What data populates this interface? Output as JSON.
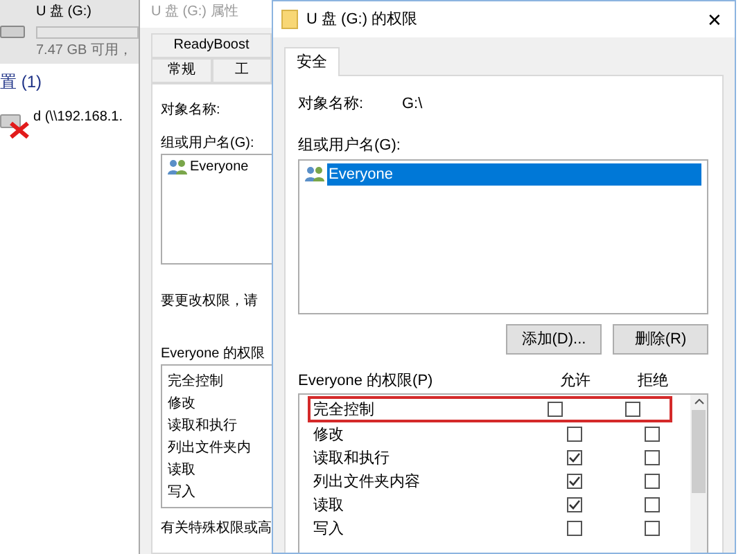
{
  "explorer": {
    "drive_name": "U 盘 (G:)",
    "drive_free": "7.47 GB 可用，",
    "section": "置 (1)",
    "network_drive": "d (\\\\192.168.1."
  },
  "properties": {
    "title": "U 盘 (G:) 属性",
    "tabs_top": [
      {
        "label": "ReadyBoost",
        "selected": false
      }
    ],
    "tabs": [
      {
        "label": "常规",
        "selected": false
      },
      {
        "label": "工",
        "selected": false
      }
    ],
    "object_label": "对象名称:",
    "group_label": "组或用户名(G):",
    "users": [
      "Everyone"
    ],
    "hint": "要更改权限，请",
    "perm_label": "Everyone 的权限",
    "permissions": [
      "完全控制",
      "修改",
      "读取和执行",
      "列出文件夹内",
      "读取",
      "写入"
    ],
    "footer": "有关特殊权限或高"
  },
  "dialog": {
    "title": "U 盘 (G:) 的权限",
    "close": "✕",
    "tabs": [
      {
        "label": "安全",
        "selected": true
      }
    ],
    "object_label": "对象名称:",
    "object_value": "G:\\",
    "group_label": "组或用户名(G):",
    "users": [
      {
        "name": "Everyone",
        "selected": true
      }
    ],
    "buttons": [
      "添加(D)...",
      "删除(R)"
    ],
    "perm_label": "Everyone 的权限(P)",
    "allow_header": "允许",
    "deny_header": "拒绝",
    "permissions": [
      {
        "name": "完全控制",
        "allow": false,
        "deny": false,
        "highlighted": true
      },
      {
        "name": "修改",
        "allow": false,
        "deny": false,
        "highlighted": false
      },
      {
        "name": "读取和执行",
        "allow": true,
        "deny": false,
        "highlighted": false
      },
      {
        "name": "列出文件夹内容",
        "allow": true,
        "deny": false,
        "highlighted": false
      },
      {
        "name": "读取",
        "allow": true,
        "deny": false,
        "highlighted": false
      },
      {
        "name": "写入",
        "allow": false,
        "deny": false,
        "highlighted": false
      }
    ]
  }
}
